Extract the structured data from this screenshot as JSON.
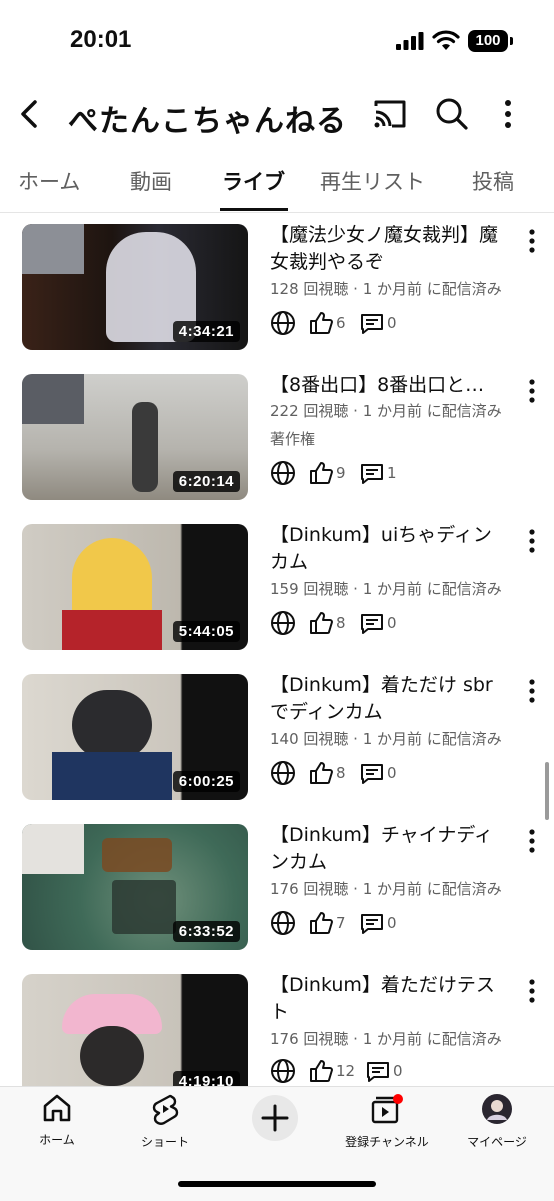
{
  "status": {
    "time": "20:01",
    "battery": "100"
  },
  "header": {
    "title": "ぺたんこちゃんねる"
  },
  "tabs": [
    "ホーム",
    "動画",
    "ライブ",
    "再生リスト",
    "投稿"
  ],
  "active_tab": "ライブ",
  "videos": [
    {
      "title": "【魔法少女ノ魔女裁判】魔女裁判やるぞ",
      "meta": "128 回視聴 · 1 か月前 に配信済み",
      "extra": "",
      "duration": "4:34:21",
      "likes": "6",
      "comments": "0",
      "thumb_color": "#2a1a1a"
    },
    {
      "title": "【8番出口】8番出口と…",
      "meta": "222 回視聴 · 1 か月前 に配信済み",
      "extra": "著作権",
      "duration": "6:20:14",
      "likes": "9",
      "comments": "1",
      "thumb_color": "#b8b8b4"
    },
    {
      "title": "【Dinkum】uiちゃディンカム",
      "meta": "159 回視聴 · 1 か月前 に配信済み",
      "extra": "",
      "duration": "5:44:05",
      "likes": "8",
      "comments": "0",
      "thumb_color": "#c9c4bb"
    },
    {
      "title": "【Dinkum】着ただけ sbr でディンカム",
      "meta": "140 回視聴 · 1 か月前 に配信済み",
      "extra": "",
      "duration": "6:00:25",
      "likes": "8",
      "comments": "0",
      "thumb_color": "#d7d3cc"
    },
    {
      "title": "【Dinkum】チャイナディンカム",
      "meta": "176 回視聴 · 1 か月前 に配信済み",
      "extra": "",
      "duration": "6:33:52",
      "likes": "7",
      "comments": "0",
      "thumb_color": "#3d6a5a"
    },
    {
      "title": "【Dinkum】着ただけテスト",
      "meta": "176 回視聴 · 1 か月前 に配信済み",
      "extra": "",
      "duration": "4:19:10",
      "likes": "12",
      "comments": "0",
      "thumb_color": "#cfcac3"
    }
  ],
  "bottom_nav": {
    "home": "ホーム",
    "shorts": "ショート",
    "subscriptions": "登録チャンネル",
    "you": "マイページ"
  },
  "colors": {
    "text": "#0f0f0f",
    "secondary": "#606060",
    "notification": "#ff0000"
  }
}
